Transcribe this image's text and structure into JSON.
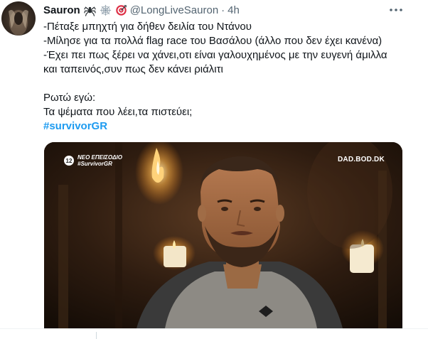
{
  "tweet": {
    "display_name": "Sauron",
    "handle": "@LongLiveSauron",
    "separator": "·",
    "time": "4h",
    "name_emojis": [
      "spider-icon",
      "spider-web-icon",
      "target-icon"
    ],
    "text_lines": [
      "-Πέταξε μπηχτή για δήθεν δειλία του Ντάνου",
      "-Μίλησε για τα πολλά flag race του Βασάλου (άλλο που δεν έχει κανένα)",
      "-Έχει πει πως ξέρει να χάνει,οτι είναι γαλουχημένος με την ευγενή άμιλλα",
      "και ταπεινός,συν πως δεν κάνει ριάλιτι",
      "",
      "Ρωτώ εγώ:",
      "Τα ψέματα που λέει,τα πιστεύει;"
    ],
    "hashtag": "#survivorGR",
    "accent_color": "#1d9bf0"
  },
  "media": {
    "channel_number": "12",
    "overlay_line1": "ΝΕΟ ΕΠΕΙΣΟΔΙΟ",
    "overlay_line2": "#SurvivorGR",
    "watermark": "DAD.BOD.DK"
  }
}
